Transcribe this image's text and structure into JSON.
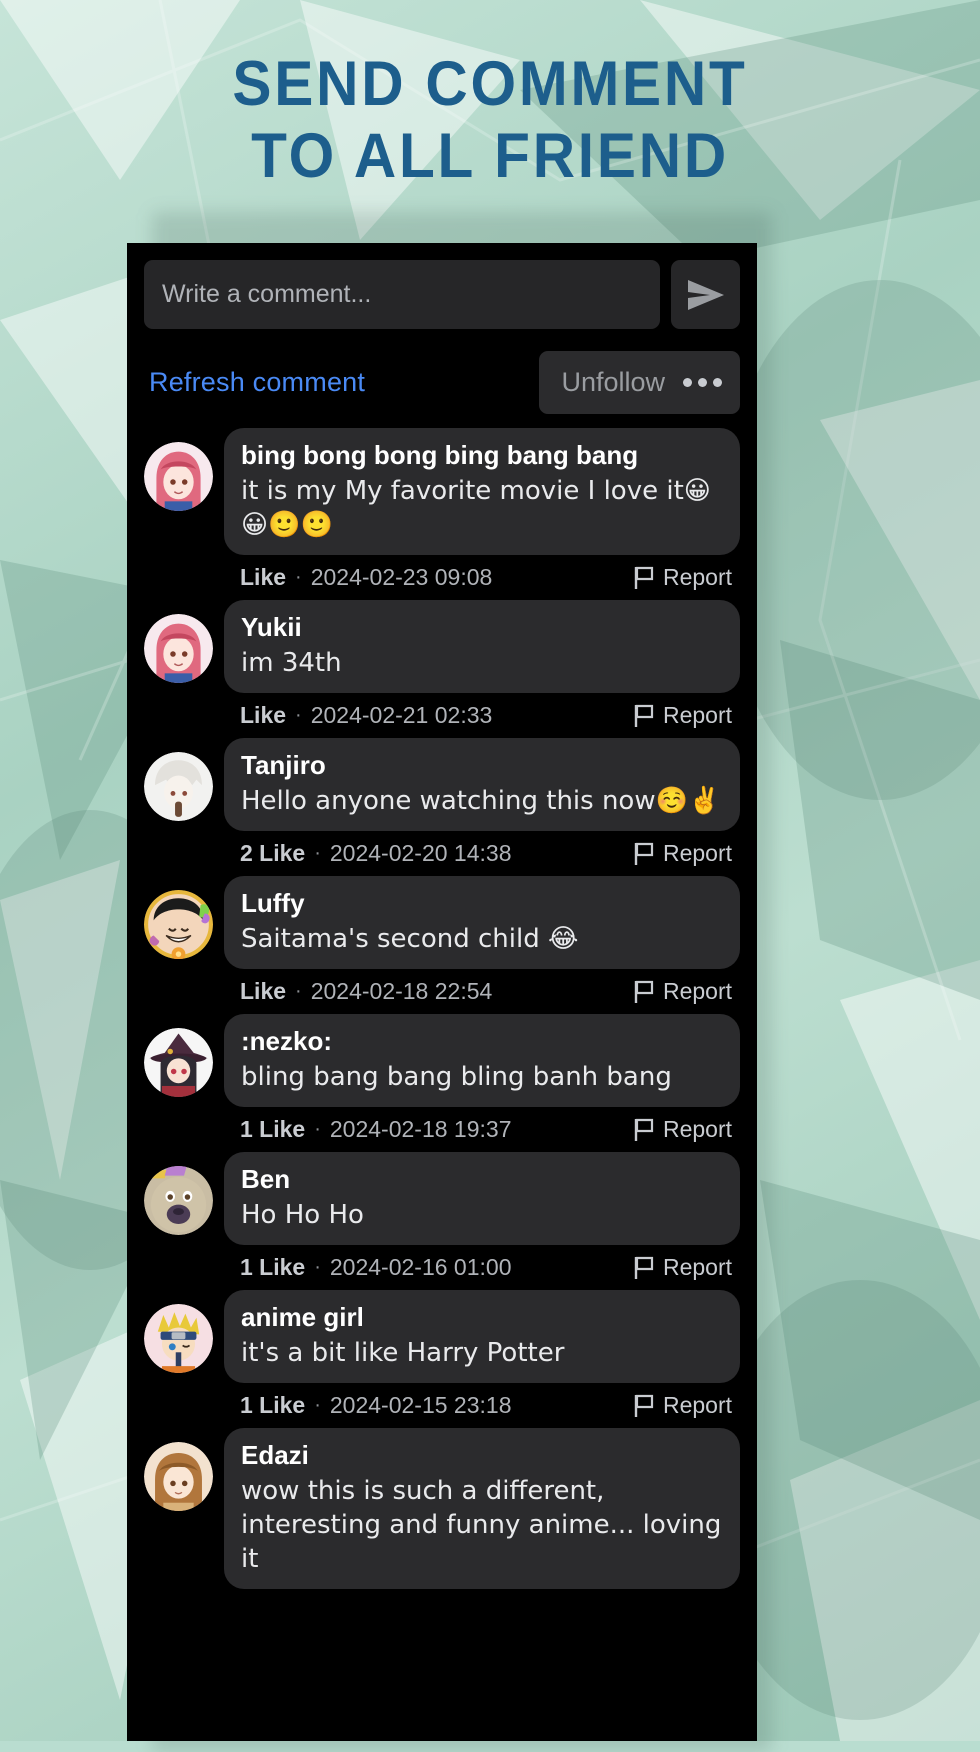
{
  "headline": {
    "line1": "SEND COMMENT",
    "line2": "TO ALL FRIEND",
    "color": "#1d5e8c"
  },
  "background": {
    "color": "#b9ddd0"
  },
  "composer": {
    "placeholder": "Write a comment...",
    "value": "",
    "send_icon": "send-paper-plane-icon"
  },
  "actions": {
    "refresh_label": "Refresh comment",
    "refresh_color": "#4a8af5",
    "unfollow_label": "Unfollow",
    "more_icon": "more-horizontal-icon"
  },
  "labels": {
    "separator": "·",
    "report": "Report",
    "flag_icon": "flag-icon"
  },
  "comments": [
    {
      "name": "bing bong bong bing bang bang",
      "body": "it is my My favorite movie I love it😀😀🙂🙂",
      "likes": "Like",
      "time": "2024-02-23 09:08",
      "avatar": "pink-haired-anime-girl",
      "framed": false
    },
    {
      "name": "Yukii",
      "body": "im 34th",
      "likes": "Like",
      "time": "2024-02-21 02:33",
      "avatar": "pink-haired-anime-girl",
      "framed": false
    },
    {
      "name": "Tanjiro",
      "body": "Hello anyone watching this now☺️✌️",
      "likes": "2 Like",
      "time": "2024-02-20 14:38",
      "avatar": "white-haired-anime-boy",
      "framed": false
    },
    {
      "name": "Luffy",
      "body": "Saitama's second child 😂",
      "likes": "Like",
      "time": "2024-02-18 22:54",
      "avatar": "luffy-smiling",
      "framed": true
    },
    {
      "name": ":nezko:",
      "body": "bling bang bang bling banh bang",
      "likes": "1 Like",
      "time": "2024-02-18 19:37",
      "avatar": "witch-hat-anime-girl",
      "framed": false
    },
    {
      "name": "Ben",
      "body": "Ho Ho Ho",
      "likes": "1 Like",
      "time": "2024-02-16 01:00",
      "avatar": "dog-face",
      "framed": false
    },
    {
      "name": "anime girl",
      "body": "it's a bit like Harry Potter",
      "likes": "1 Like",
      "time": "2024-02-15 23:18",
      "avatar": "naruto-chibi",
      "framed": false
    },
    {
      "name": "Edazi",
      "body": "wow this is such a different, interesting and funny anime... loving it",
      "likes": "",
      "time": "",
      "avatar": "brown-haired-anime-girl",
      "framed": false
    }
  ]
}
